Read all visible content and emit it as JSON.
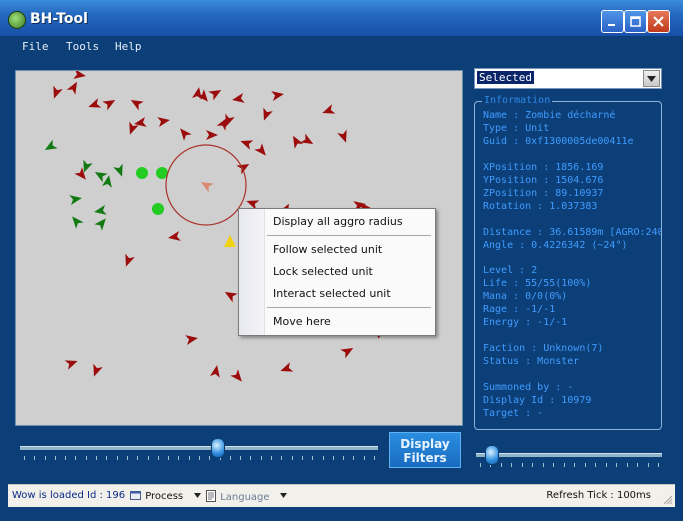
{
  "window": {
    "title": "BH-Tool"
  },
  "menu": {
    "items": [
      "File",
      "Tools",
      "Help"
    ]
  },
  "map": {
    "context_menu": {
      "items": [
        "Display all aggro radius",
        "Follow selected unit",
        "Lock selected unit",
        "Interact selected unit",
        "Move here"
      ]
    },
    "colors": {
      "hostile": "#9b0c0c",
      "friendly": "#137a13",
      "friendly_dot": "#22cc22",
      "player": "#d98a70",
      "aggro_circle": "#a8332a",
      "target": "#f2d20e"
    }
  },
  "filter": {
    "selected_value": "Selected"
  },
  "info": {
    "legend": "Information",
    "lines": [
      "Name : Zombie décharné",
      "Type : Unit",
      "Guid : 0xf1300005de00411e",
      "",
      "XPosition : 1856.169",
      "YPosition : 1504.676",
      "ZPosition : 89.10937",
      "Rotation : 1.037383",
      "",
      "Distance : 36.61589m [AGRO:240",
      "Angle : 0.4226342 (~24°)",
      "",
      "Level : 2",
      "Life : 55/55(100%)",
      "Mana : 0/0(0%)",
      "Rage : -1/-1",
      "Energy : -1/-1",
      "",
      "Faction : Unknown(7)",
      "Status : Monster",
      "",
      "Summoned by : -",
      "Display Id : 10979",
      "Target : -"
    ]
  },
  "controls": {
    "display_filters_line1": "Display",
    "display_filters_line2": "Filters",
    "zoom_level": 0.55,
    "tick_level": 0.08
  },
  "status": {
    "wow_loaded": "Wow is loaded Id : 196",
    "process": "Process",
    "language": "Language",
    "refresh_tick": "Refresh Tick : 100ms"
  }
}
